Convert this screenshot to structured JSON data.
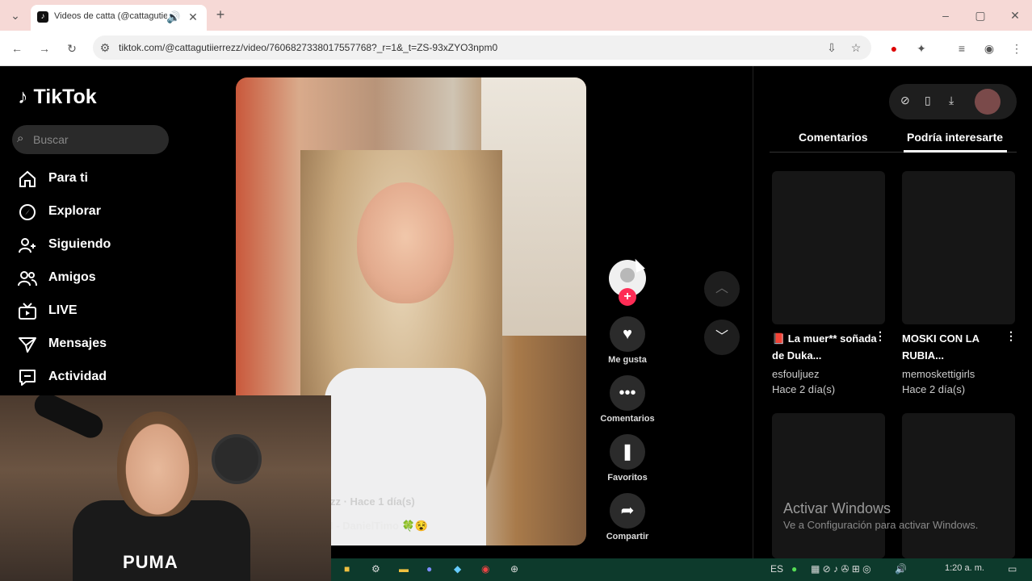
{
  "browser": {
    "tab_title": "Videos de catta (@cattagutierrezz)",
    "url": "tiktok.com/@cattagutiierrezz/video/7606827338017557768?_r=1&_t=ZS-93xZYO3npm0",
    "new_tab": "+",
    "window_controls": [
      "–",
      "▢",
      "✕"
    ]
  },
  "tiktok": {
    "logo": "TikTok",
    "search_placeholder": "Buscar",
    "nav": [
      {
        "label": "Para ti",
        "icon": "home-icon"
      },
      {
        "label": "Explorar",
        "icon": "compass-icon"
      },
      {
        "label": "Siguiendo",
        "icon": "user-follow-icon"
      },
      {
        "label": "Amigos",
        "icon": "friends-icon"
      },
      {
        "label": "LIVE",
        "icon": "live-icon"
      },
      {
        "label": "Mensajes",
        "icon": "send-icon"
      },
      {
        "label": "Actividad",
        "icon": "message-box-icon"
      }
    ],
    "video": {
      "caption_line1": "zz · Hace 1 día(s)",
      "caption_line2": "I - DanielTimo 🍀😵"
    },
    "actions": [
      {
        "label": "Me gusta",
        "icon": "heart-icon"
      },
      {
        "label": "Comentarios",
        "icon": "comment-icon"
      },
      {
        "label": "Favoritos",
        "icon": "bookmark-icon"
      },
      {
        "label": "Compartir",
        "icon": "share-icon"
      }
    ],
    "right_tabs": [
      "Comentarios",
      "Podría interesarte"
    ],
    "suggestions": [
      {
        "title": "📕 La muer** soñada de Duka...",
        "user": "esfouljuez",
        "date": "Hace 2 día(s)"
      },
      {
        "title": "MOSKI CON LA RUBIA...",
        "user": "memoskettigirls",
        "date": "Hace 2 día(s)"
      }
    ],
    "windows_watermark": {
      "title": "Activar Windows",
      "subtitle": "Ve a Configuración para activar Windows."
    }
  },
  "overlay": {
    "shirt_text": "PUMA"
  },
  "taskbar": {
    "language": "ES",
    "time": "1:20 a. m."
  }
}
